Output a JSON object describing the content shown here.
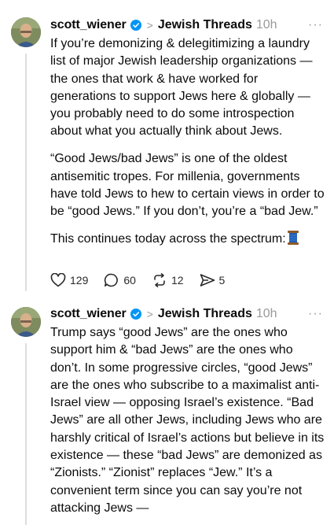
{
  "posts": [
    {
      "username": "scott_wiener",
      "community": "Jewish Threads",
      "time": "10h",
      "more": "···",
      "paragraphs": [
        "If you’re demonizing & delegitimizing a laundry list of major Jewish leadership organizations — the ones that work & have worked for generations to support Jews here & globally — you probably need to do some introspection about what you actually think about Jews.",
        "“Good Jews/bad Jews” is one of the oldest antisemitic tropes. For millenia, governments have told Jews to hew to certain views in order to be “good Jews.” If you don’t, you’re a “bad Jew.”",
        "This continues today across the spectrum:"
      ],
      "actions": {
        "likes": "129",
        "replies": "60",
        "reposts": "12",
        "shares": "5"
      },
      "icons": {
        "verified": "verified-badge-icon",
        "thread_emoji": "spool-of-thread-icon"
      }
    },
    {
      "username": "scott_wiener",
      "community": "Jewish Threads",
      "time": "10h",
      "more": "···",
      "text": "Trump says “good Jews” are the ones who support him & “bad Jews” are the ones who don’t. In some progressive circles, “good Jews” are the ones who subscribe to a maximalist anti-Israel view — opposing Israel’s existence. “Bad Jews” are all other Jews, including Jews who are harshly critical of Israel’s actions but believe in its existence — these “bad Jews” are demonized as “Zionists.” “Zionist” replaces “Jew.” It’s a convenient term since you can say you’re not attacking Jews —"
    }
  ],
  "colors": {
    "verified": "#0095f6",
    "muted": "#9a9a9a",
    "thread_line": "#dcdcdc"
  }
}
